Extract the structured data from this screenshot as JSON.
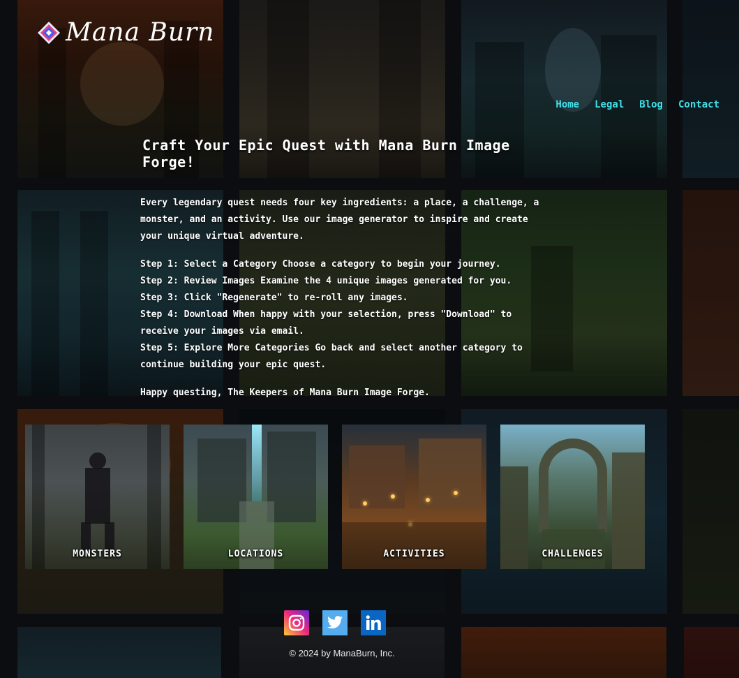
{
  "brand": {
    "name": "Mana Burn",
    "logo_icon": "mana-crystal-icon"
  },
  "nav": [
    {
      "label": "Home"
    },
    {
      "label": "Legal"
    },
    {
      "label": "Blog"
    },
    {
      "label": "Contact"
    }
  ],
  "hero": {
    "headline": "Craft Your Epic Quest with Mana Burn Image Forge!",
    "intro": "Every legendary quest needs four key ingredients: a place, a challenge, a monster, and an activity. Use our image generator to inspire and create your unique virtual adventure.",
    "steps": [
      "Step 1: Select a Category Choose a category to begin your journey.",
      "Step 2: Review Images Examine the 4 unique images generated for you.",
      "Step 3: Click \"Regenerate\" to re-roll any images.",
      "Step 4: Download When happy with your selection, press \"Download\" to receive your images via email.",
      "Step 5: Explore More Categories Go back and select another category to continue building your epic quest."
    ],
    "signoff": "Happy questing, The Keepers of Mana Burn Image Forge."
  },
  "categories": [
    {
      "label": "MONSTERS"
    },
    {
      "label": "LOCATIONS"
    },
    {
      "label": "ACTIVITIES"
    },
    {
      "label": "CHALLENGES"
    }
  ],
  "social": [
    {
      "name": "instagram-icon",
      "color": "#ee2a7b"
    },
    {
      "name": "twitter-icon",
      "color": "#55acee"
    },
    {
      "name": "linkedin-icon",
      "color": "#0a66c2"
    }
  ],
  "footer": {
    "copyright": "© 2024 by ManaBurn, Inc."
  },
  "colors": {
    "nav_link": "#40e0e8",
    "background": "#0b0d10",
    "text": "#ffffff"
  }
}
